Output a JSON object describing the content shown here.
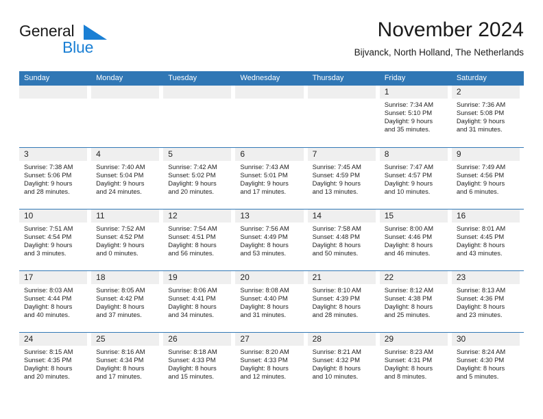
{
  "brand": {
    "name_dark": "General",
    "name_blue": "Blue",
    "triangle_color": "#1a7fd4",
    "blue_text_color": "#1a7fd4",
    "dark_text_color": "#1a1a1a"
  },
  "header": {
    "title": "November 2024",
    "subtitle": "Bijvanck, North Holland, The Netherlands"
  },
  "colors": {
    "header_blue": "#3077b5",
    "daynum_band": "#efefef",
    "row_separator": "#3077b5",
    "text": "#222222"
  },
  "weekdays": [
    "Sunday",
    "Monday",
    "Tuesday",
    "Wednesday",
    "Thursday",
    "Friday",
    "Saturday"
  ],
  "weeks": [
    [
      {
        "day": "",
        "empty": true
      },
      {
        "day": "",
        "empty": true
      },
      {
        "day": "",
        "empty": true
      },
      {
        "day": "",
        "empty": true
      },
      {
        "day": "",
        "empty": true
      },
      {
        "day": "1",
        "sunrise": "Sunrise: 7:34 AM",
        "sunset": "Sunset: 5:10 PM",
        "daylight1": "Daylight: 9 hours",
        "daylight2": "and 35 minutes."
      },
      {
        "day": "2",
        "sunrise": "Sunrise: 7:36 AM",
        "sunset": "Sunset: 5:08 PM",
        "daylight1": "Daylight: 9 hours",
        "daylight2": "and 31 minutes."
      }
    ],
    [
      {
        "day": "3",
        "sunrise": "Sunrise: 7:38 AM",
        "sunset": "Sunset: 5:06 PM",
        "daylight1": "Daylight: 9 hours",
        "daylight2": "and 28 minutes."
      },
      {
        "day": "4",
        "sunrise": "Sunrise: 7:40 AM",
        "sunset": "Sunset: 5:04 PM",
        "daylight1": "Daylight: 9 hours",
        "daylight2": "and 24 minutes."
      },
      {
        "day": "5",
        "sunrise": "Sunrise: 7:42 AM",
        "sunset": "Sunset: 5:02 PM",
        "daylight1": "Daylight: 9 hours",
        "daylight2": "and 20 minutes."
      },
      {
        "day": "6",
        "sunrise": "Sunrise: 7:43 AM",
        "sunset": "Sunset: 5:01 PM",
        "daylight1": "Daylight: 9 hours",
        "daylight2": "and 17 minutes."
      },
      {
        "day": "7",
        "sunrise": "Sunrise: 7:45 AM",
        "sunset": "Sunset: 4:59 PM",
        "daylight1": "Daylight: 9 hours",
        "daylight2": "and 13 minutes."
      },
      {
        "day": "8",
        "sunrise": "Sunrise: 7:47 AM",
        "sunset": "Sunset: 4:57 PM",
        "daylight1": "Daylight: 9 hours",
        "daylight2": "and 10 minutes."
      },
      {
        "day": "9",
        "sunrise": "Sunrise: 7:49 AM",
        "sunset": "Sunset: 4:56 PM",
        "daylight1": "Daylight: 9 hours",
        "daylight2": "and 6 minutes."
      }
    ],
    [
      {
        "day": "10",
        "sunrise": "Sunrise: 7:51 AM",
        "sunset": "Sunset: 4:54 PM",
        "daylight1": "Daylight: 9 hours",
        "daylight2": "and 3 minutes."
      },
      {
        "day": "11",
        "sunrise": "Sunrise: 7:52 AM",
        "sunset": "Sunset: 4:52 PM",
        "daylight1": "Daylight: 9 hours",
        "daylight2": "and 0 minutes."
      },
      {
        "day": "12",
        "sunrise": "Sunrise: 7:54 AM",
        "sunset": "Sunset: 4:51 PM",
        "daylight1": "Daylight: 8 hours",
        "daylight2": "and 56 minutes."
      },
      {
        "day": "13",
        "sunrise": "Sunrise: 7:56 AM",
        "sunset": "Sunset: 4:49 PM",
        "daylight1": "Daylight: 8 hours",
        "daylight2": "and 53 minutes."
      },
      {
        "day": "14",
        "sunrise": "Sunrise: 7:58 AM",
        "sunset": "Sunset: 4:48 PM",
        "daylight1": "Daylight: 8 hours",
        "daylight2": "and 50 minutes."
      },
      {
        "day": "15",
        "sunrise": "Sunrise: 8:00 AM",
        "sunset": "Sunset: 4:46 PM",
        "daylight1": "Daylight: 8 hours",
        "daylight2": "and 46 minutes."
      },
      {
        "day": "16",
        "sunrise": "Sunrise: 8:01 AM",
        "sunset": "Sunset: 4:45 PM",
        "daylight1": "Daylight: 8 hours",
        "daylight2": "and 43 minutes."
      }
    ],
    [
      {
        "day": "17",
        "sunrise": "Sunrise: 8:03 AM",
        "sunset": "Sunset: 4:44 PM",
        "daylight1": "Daylight: 8 hours",
        "daylight2": "and 40 minutes."
      },
      {
        "day": "18",
        "sunrise": "Sunrise: 8:05 AM",
        "sunset": "Sunset: 4:42 PM",
        "daylight1": "Daylight: 8 hours",
        "daylight2": "and 37 minutes."
      },
      {
        "day": "19",
        "sunrise": "Sunrise: 8:06 AM",
        "sunset": "Sunset: 4:41 PM",
        "daylight1": "Daylight: 8 hours",
        "daylight2": "and 34 minutes."
      },
      {
        "day": "20",
        "sunrise": "Sunrise: 8:08 AM",
        "sunset": "Sunset: 4:40 PM",
        "daylight1": "Daylight: 8 hours",
        "daylight2": "and 31 minutes."
      },
      {
        "day": "21",
        "sunrise": "Sunrise: 8:10 AM",
        "sunset": "Sunset: 4:39 PM",
        "daylight1": "Daylight: 8 hours",
        "daylight2": "and 28 minutes."
      },
      {
        "day": "22",
        "sunrise": "Sunrise: 8:12 AM",
        "sunset": "Sunset: 4:38 PM",
        "daylight1": "Daylight: 8 hours",
        "daylight2": "and 25 minutes."
      },
      {
        "day": "23",
        "sunrise": "Sunrise: 8:13 AM",
        "sunset": "Sunset: 4:36 PM",
        "daylight1": "Daylight: 8 hours",
        "daylight2": "and 23 minutes."
      }
    ],
    [
      {
        "day": "24",
        "sunrise": "Sunrise: 8:15 AM",
        "sunset": "Sunset: 4:35 PM",
        "daylight1": "Daylight: 8 hours",
        "daylight2": "and 20 minutes."
      },
      {
        "day": "25",
        "sunrise": "Sunrise: 8:16 AM",
        "sunset": "Sunset: 4:34 PM",
        "daylight1": "Daylight: 8 hours",
        "daylight2": "and 17 minutes."
      },
      {
        "day": "26",
        "sunrise": "Sunrise: 8:18 AM",
        "sunset": "Sunset: 4:33 PM",
        "daylight1": "Daylight: 8 hours",
        "daylight2": "and 15 minutes."
      },
      {
        "day": "27",
        "sunrise": "Sunrise: 8:20 AM",
        "sunset": "Sunset: 4:33 PM",
        "daylight1": "Daylight: 8 hours",
        "daylight2": "and 12 minutes."
      },
      {
        "day": "28",
        "sunrise": "Sunrise: 8:21 AM",
        "sunset": "Sunset: 4:32 PM",
        "daylight1": "Daylight: 8 hours",
        "daylight2": "and 10 minutes."
      },
      {
        "day": "29",
        "sunrise": "Sunrise: 8:23 AM",
        "sunset": "Sunset: 4:31 PM",
        "daylight1": "Daylight: 8 hours",
        "daylight2": "and 8 minutes."
      },
      {
        "day": "30",
        "sunrise": "Sunrise: 8:24 AM",
        "sunset": "Sunset: 4:30 PM",
        "daylight1": "Daylight: 8 hours",
        "daylight2": "and 5 minutes."
      }
    ]
  ]
}
